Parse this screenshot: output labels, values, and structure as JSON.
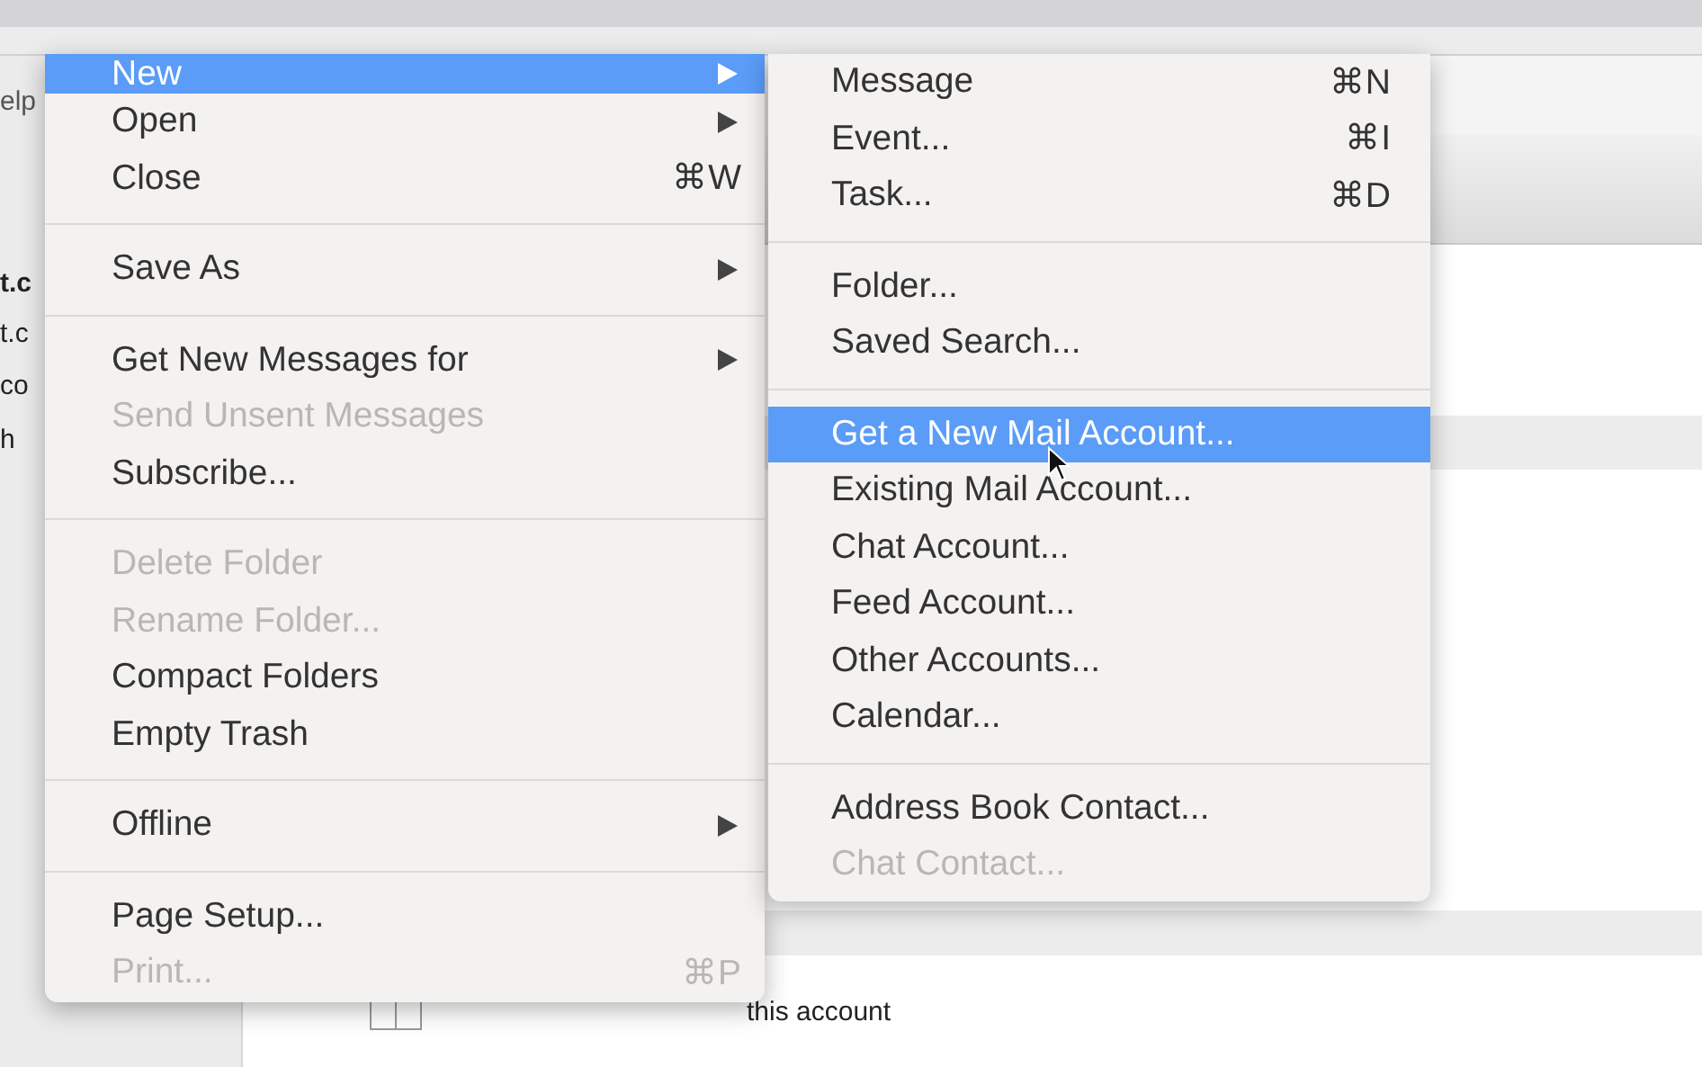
{
  "background": {
    "sidebar_fragments": [
      "elp",
      "t.c",
      "t.c",
      "co",
      "h"
    ],
    "content_text": "this account"
  },
  "menu": {
    "items": [
      {
        "kind": "item",
        "label": "New",
        "has_submenu": true,
        "disabled": false,
        "selected": true
      },
      {
        "kind": "item",
        "label": "Open",
        "has_submenu": true,
        "disabled": false,
        "selected": false
      },
      {
        "kind": "item",
        "label": "Close",
        "shortcut": "⌘W",
        "disabled": false,
        "selected": false
      },
      {
        "kind": "separator"
      },
      {
        "kind": "item",
        "label": "Save As",
        "has_submenu": true,
        "disabled": false,
        "selected": false
      },
      {
        "kind": "separator"
      },
      {
        "kind": "item",
        "label": "Get New Messages for",
        "has_submenu": true,
        "disabled": false,
        "selected": false
      },
      {
        "kind": "item",
        "label": "Send Unsent Messages",
        "disabled": true,
        "selected": false
      },
      {
        "kind": "item",
        "label": "Subscribe...",
        "disabled": false,
        "selected": false
      },
      {
        "kind": "separator"
      },
      {
        "kind": "item",
        "label": "Delete Folder",
        "disabled": true,
        "selected": false
      },
      {
        "kind": "item",
        "label": "Rename Folder...",
        "disabled": true,
        "selected": false
      },
      {
        "kind": "item",
        "label": "Compact Folders",
        "disabled": false,
        "selected": false
      },
      {
        "kind": "item",
        "label": "Empty Trash",
        "disabled": false,
        "selected": false
      },
      {
        "kind": "separator"
      },
      {
        "kind": "item",
        "label": "Offline",
        "has_submenu": true,
        "disabled": false,
        "selected": false
      },
      {
        "kind": "separator"
      },
      {
        "kind": "item",
        "label": "Page Setup...",
        "disabled": false,
        "selected": false
      },
      {
        "kind": "item",
        "label": "Print...",
        "shortcut": "⌘P",
        "disabled": true,
        "selected": false
      }
    ]
  },
  "submenu": {
    "items": [
      {
        "kind": "item",
        "label": "Message",
        "shortcut": "⌘N",
        "disabled": false,
        "selected": false
      },
      {
        "kind": "item",
        "label": "Event...",
        "shortcut": "⌘I",
        "disabled": false,
        "selected": false
      },
      {
        "kind": "item",
        "label": "Task...",
        "shortcut": "⌘D",
        "disabled": false,
        "selected": false
      },
      {
        "kind": "separator"
      },
      {
        "kind": "item",
        "label": "Folder...",
        "disabled": false,
        "selected": false
      },
      {
        "kind": "item",
        "label": "Saved Search...",
        "disabled": false,
        "selected": false
      },
      {
        "kind": "separator"
      },
      {
        "kind": "item",
        "label": "Get a New Mail Account...",
        "disabled": false,
        "selected": true
      },
      {
        "kind": "item",
        "label": "Existing Mail Account...",
        "disabled": false,
        "selected": false
      },
      {
        "kind": "item",
        "label": "Chat Account...",
        "disabled": false,
        "selected": false
      },
      {
        "kind": "item",
        "label": "Feed Account...",
        "disabled": false,
        "selected": false
      },
      {
        "kind": "item",
        "label": "Other Accounts...",
        "disabled": false,
        "selected": false
      },
      {
        "kind": "item",
        "label": "Calendar...",
        "disabled": false,
        "selected": false
      },
      {
        "kind": "separator"
      },
      {
        "kind": "item",
        "label": "Address Book Contact...",
        "disabled": false,
        "selected": false
      },
      {
        "kind": "item",
        "label": "Chat Contact...",
        "disabled": true,
        "selected": false
      }
    ]
  }
}
